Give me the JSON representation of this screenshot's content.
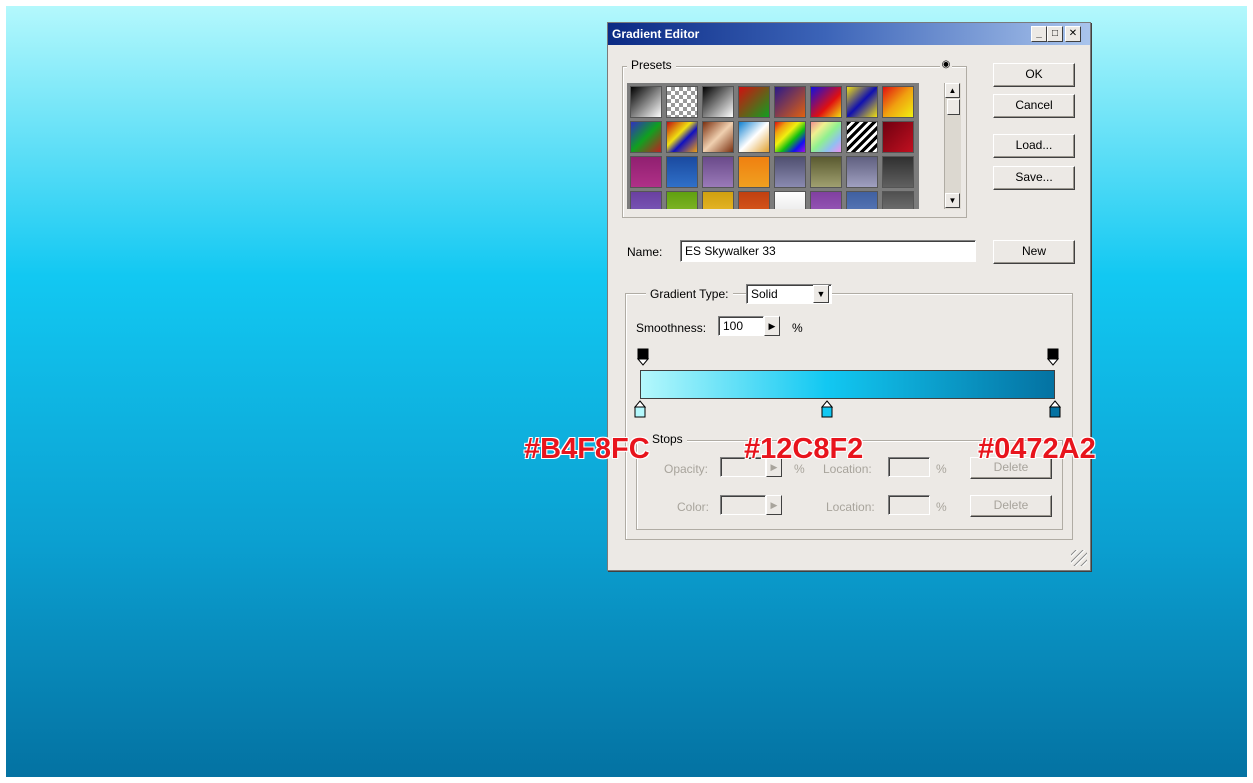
{
  "window": {
    "title": "Gradient Editor",
    "minimize": "_",
    "maximize": "□",
    "close": "✕"
  },
  "buttons": {
    "ok": "OK",
    "cancel": "Cancel",
    "load": "Load...",
    "save": "Save...",
    "new": "New"
  },
  "presets": {
    "label": "Presets",
    "menu_icon": "circle-arrow-icon",
    "swatches": [
      {
        "gradient": "linear-gradient(135deg,#000 0%,#fff 100%)"
      },
      {
        "gradient": "repeating-conic-gradient(#999 0% 25%,#fff 0% 50%) 0 0/8px 8px"
      },
      {
        "gradient": "linear-gradient(135deg,#000 0%,#fff 100%)"
      },
      {
        "gradient": "linear-gradient(135deg,#d01010 0%,#10a020 100%)"
      },
      {
        "gradient": "linear-gradient(135deg,#2a1a8a 0%,#e06010 100%)"
      },
      {
        "gradient": "linear-gradient(135deg,#1010e0 0%,#e01010 60%,#f0e010 100%)"
      },
      {
        "gradient": "linear-gradient(135deg,#f0e010 0%,#1010b0 50%,#f0e010 100%)"
      },
      {
        "gradient": "linear-gradient(135deg,#e01010 0%,#f0a010 50%,#f0f010 100%)"
      },
      {
        "gradient": "linear-gradient(135deg,#3030c0 0%,#10a020 50%,#c02020 100%)"
      },
      {
        "gradient": "linear-gradient(135deg,#c01010 0%,#f0e010 40%,#1010c0 60%,#f0a010 100%)"
      },
      {
        "gradient": "linear-gradient(135deg,#7a3010 0%,#f0d0b0 50%,#7a3010 100%)"
      },
      {
        "gradient": "linear-gradient(135deg,#1080d0 0%,#ffffff 50%,#e0a030 100%)"
      },
      {
        "gradient": "linear-gradient(135deg,#e01010,#f0a010,#f0f010,#10c010,#1010f0,#a010e0)"
      },
      {
        "gradient": "linear-gradient(135deg,#f09090,#f0f090,#90f090,#90c0f0,#f090f0)"
      },
      {
        "gradient": "repeating-linear-gradient(135deg,#000 0 3px,#fff 3px 6px)"
      },
      {
        "gradient": "linear-gradient(135deg,#700010 0%,#c01020 100%)"
      },
      {
        "gradient": "linear-gradient(to bottom,#902070 0%,#b03088 100%)"
      },
      {
        "gradient": "linear-gradient(to bottom,#1a4aa0 0%,#3070c8 100%)"
      },
      {
        "gradient": "linear-gradient(to bottom,#6a4a8a 0%,#9a7ab8 100%)"
      },
      {
        "gradient": "linear-gradient(to bottom,#f08010 0%,#f0a020 100%)"
      },
      {
        "gradient": "linear-gradient(to bottom,#505070 0%,#8a8ab0 100%)"
      },
      {
        "gradient": "linear-gradient(to bottom,#5a5a30 0%,#a0a070 100%)"
      },
      {
        "gradient": "linear-gradient(to bottom,#606080 0%,#a0a0c0 100%)"
      },
      {
        "gradient": "linear-gradient(to bottom,#303030 0%,#606060 100%)"
      },
      {
        "gradient": "linear-gradient(to bottom,#6a40a0 0%,#8060c0 100%)"
      },
      {
        "gradient": "linear-gradient(to bottom,#60a010 0%,#90c030 100%)"
      },
      {
        "gradient": "linear-gradient(to bottom,#d0a010 0%,#f0c030 100%)"
      },
      {
        "gradient": "linear-gradient(to bottom,#c04010 0%,#e06020 100%)"
      },
      {
        "gradient": "linear-gradient(to bottom,#ffffff 0%,#e0e0e0 100%)"
      },
      {
        "gradient": "linear-gradient(to bottom,#8040a0 0%,#a060c0 100%)"
      },
      {
        "gradient": "linear-gradient(to bottom,#4060a0 0%,#6080c0 100%)"
      },
      {
        "gradient": "linear-gradient(to bottom,#505050 0%,#808080 100%)"
      }
    ]
  },
  "name": {
    "label": "Name:",
    "value": "ES Skywalker 33"
  },
  "gradient_type": {
    "label": "Gradient Type:",
    "value": "Solid"
  },
  "smoothness": {
    "label": "Smoothness:",
    "value": "100",
    "unit": "%"
  },
  "gradient": {
    "stops": [
      {
        "color": "#B4F8FC",
        "location": 0
      },
      {
        "color": "#12C8F2",
        "location": 45
      },
      {
        "color": "#0472A2",
        "location": 100
      }
    ]
  },
  "stops": {
    "label": "Stops",
    "opacity_label": "Opacity:",
    "color_label": "Color:",
    "location_label": "Location:",
    "percent": "%",
    "delete_label": "Delete"
  },
  "annotations": {
    "left": "#B4F8FC",
    "middle": "#12C8F2",
    "right": "#0472A2",
    "color": "#e8141c"
  }
}
